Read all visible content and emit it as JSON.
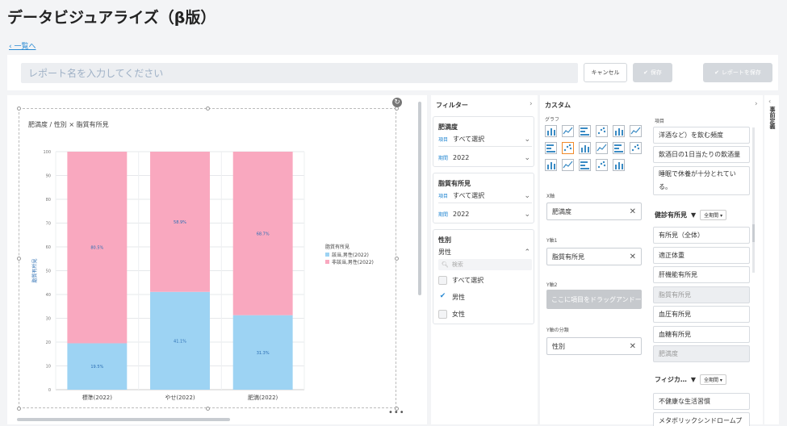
{
  "app": {
    "title": "データビジュアライズ（β版）",
    "back_link": "一覧へ"
  },
  "report": {
    "name_placeholder": "レポート名を入力してください",
    "cancel_label": "キャンセル",
    "save_label": "保存",
    "save_report_label": "レポートを保存"
  },
  "chart_data": {
    "type": "bar",
    "title": "肥満度 / 性別 × 脂質有所見",
    "ylabel": "脂質有所見",
    "xlabel": "",
    "ylim": [
      0,
      100
    ],
    "yticks": [
      0,
      10,
      20,
      30,
      40,
      50,
      60,
      70,
      80,
      90,
      100
    ],
    "categories": [
      "標準(2022)",
      "やせ(2022)",
      "肥満(2022)"
    ],
    "legend_title": "脂質有所見",
    "legend_position": "right",
    "stacked": true,
    "series": [
      {
        "name": "該当,男性(2022)",
        "values": [
          19.5,
          41.1,
          31.3
        ],
        "labels": [
          "19.5%",
          "41.1%",
          "31.3%"
        ],
        "color": "#9dd3f3"
      },
      {
        "name": "非該当,男性(2022)",
        "values": [
          80.5,
          58.9,
          68.7
        ],
        "labels": [
          "80.5%",
          "58.9%",
          "68.7%"
        ],
        "color": "#f9a8bf"
      }
    ]
  },
  "filters": {
    "title": "フィルター",
    "groups": [
      {
        "title": "肥満度",
        "item_key": "項目",
        "item_value": "すべて選択",
        "period_key": "期間",
        "period_value": "2022"
      },
      {
        "title": "脂質有所見",
        "item_key": "項目",
        "item_value": "すべて選択",
        "period_key": "期間",
        "period_value": "2022"
      }
    ],
    "gender": {
      "title": "性別",
      "value": "男性",
      "search_placeholder": "検索",
      "options": [
        "すべて選択",
        "男性",
        "女性"
      ]
    }
  },
  "custom": {
    "title": "カスタム",
    "graph_label": "グラフ",
    "x_axis_label": "X軸",
    "x_axis_value": "肥満度",
    "y1_label": "Y軸1",
    "y1_value": "脂質有所見",
    "y2_label": "Y軸2",
    "y2_placeholder": "ここに項目をドラッグアンドー",
    "ysplit_label": "Y軸の分類",
    "ysplit_value": "性別",
    "items_label": "項目",
    "top_items": [
      "洋酒など）を飲む頻度",
      "飲酒日の1日当たりの飲酒量",
      "睡眠で休養が十分とれている。"
    ],
    "section1": {
      "title": "健診有所見",
      "period": "全期間",
      "items": [
        "有所見（全体）",
        "適正体重",
        "肝機能有所見",
        "脂質有所見",
        "血圧有所見",
        "血糖有所見",
        "肥満度"
      ]
    },
    "section2": {
      "title": "フィジカ…",
      "period": "全期間",
      "items": [
        "不健康な生活習慣",
        "メタボリックシンドロームプ"
      ]
    }
  },
  "side_tab": {
    "label": "事前定義"
  }
}
